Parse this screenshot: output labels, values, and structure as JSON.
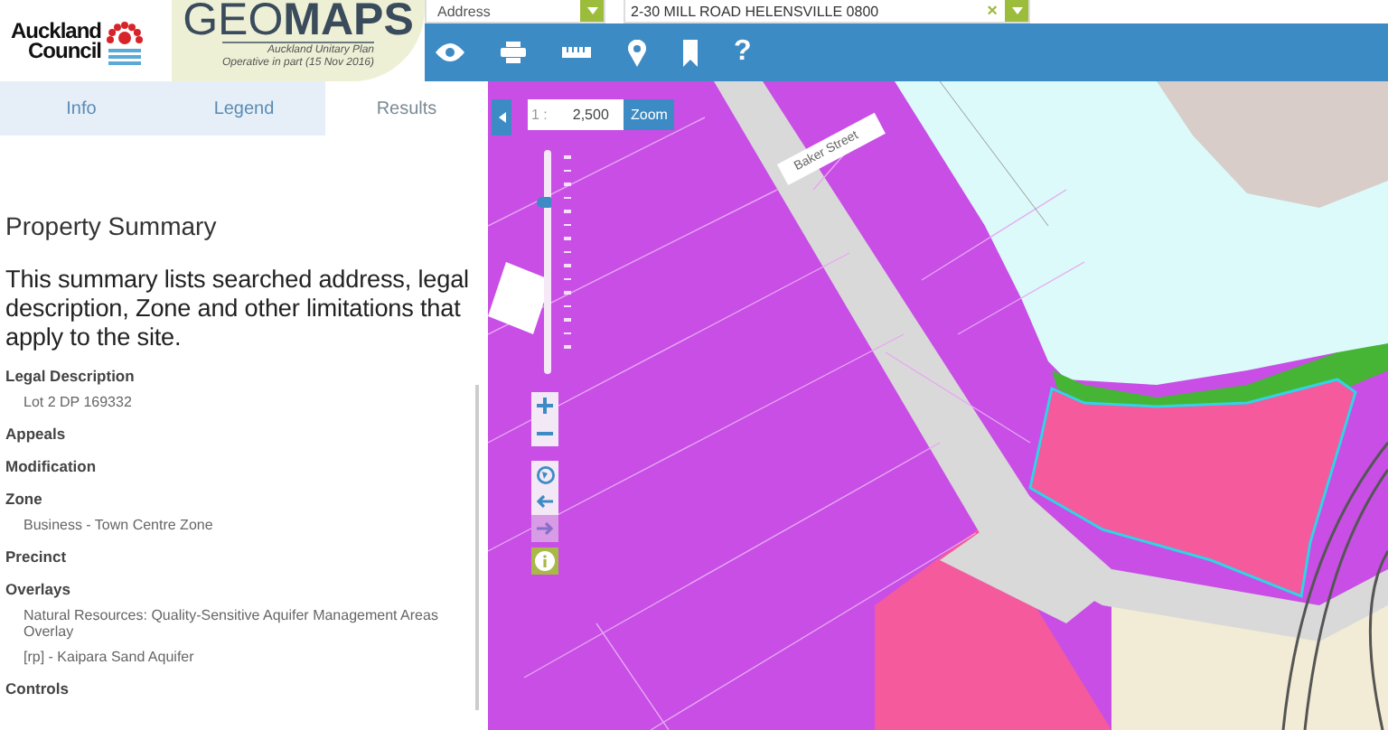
{
  "header": {
    "org_name": [
      "Auckland",
      "Council"
    ],
    "app_title": "GEO**MAPS**",
    "subtitle": [
      "Auckland Unitary Plan",
      "Operative in part (15 Nov 2016)"
    ]
  },
  "search": {
    "type_value": "Address",
    "query_value": "2-30 MILL ROAD HELENSVILLE 0800",
    "clear_label": "×"
  },
  "toolbar": {
    "help_label": "?"
  },
  "tabs": [
    {
      "label": "Info",
      "selected": false
    },
    {
      "label": "Legend",
      "selected": false
    },
    {
      "label": "Results",
      "selected": true
    }
  ],
  "results": {
    "title": "Property Summary",
    "description": "This summary lists searched address, legal description, Zone and other limitations that apply to the site.",
    "sections": [
      {
        "heading": "Legal Description",
        "values": [
          "Lot 2 DP 169332"
        ]
      },
      {
        "heading": "Appeals"
      },
      {
        "heading": "Modification"
      },
      {
        "heading": "Zone",
        "values": [
          "Business - Town Centre Zone"
        ]
      },
      {
        "heading": "Precinct"
      },
      {
        "heading": "Overlays",
        "values": [
          "Natural Resources: Quality-Sensitive Aquifer Management Areas Overlay",
          "[rp] - Kaipara Sand Aquifer"
        ]
      },
      {
        "heading": "Controls"
      }
    ]
  },
  "map": {
    "scale_prefix": "1 :",
    "scale_value": "2,500",
    "zoom_label": "Zoom",
    "zoom_slider": {
      "level": 0.78
    },
    "street_label": "Baker Street"
  }
}
